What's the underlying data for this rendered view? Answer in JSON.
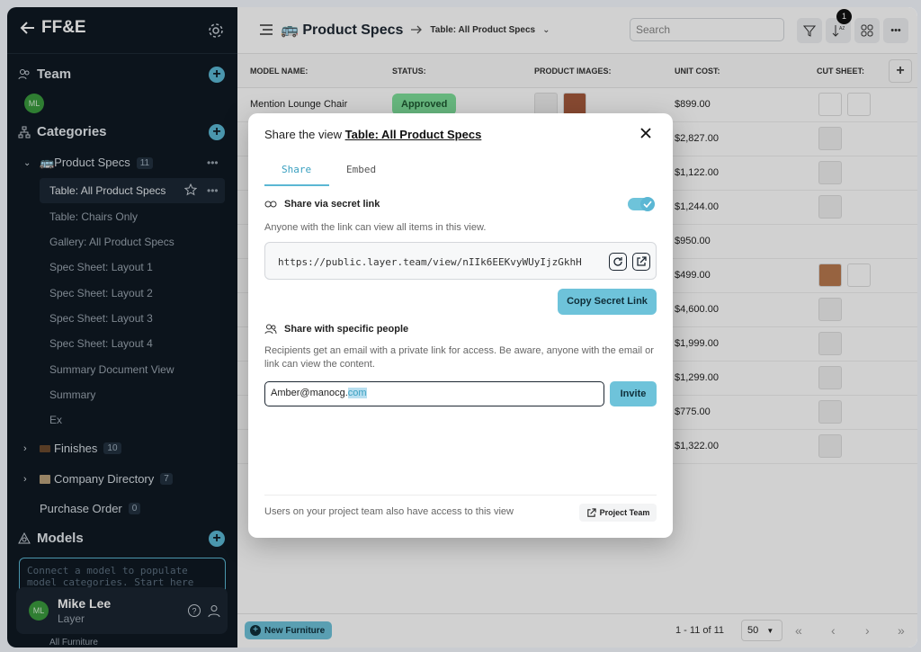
{
  "sidebar": {
    "brand": "FF&E",
    "team_label": "Team",
    "team_avatar": "ML",
    "categories_label": "Categories",
    "product_specs": {
      "label": "🚌Product Specs",
      "count": "11"
    },
    "views": [
      "Table: All Product Specs",
      "Table: Chairs Only",
      "Gallery: All Product Specs",
      "Spec Sheet: Layout 1",
      "Spec Sheet: Layout 2",
      "Spec Sheet: Layout 3",
      "Spec Sheet: Layout 4",
      "Summary Document View",
      "Summary",
      "Ex"
    ],
    "finishes": {
      "label": "Finishes",
      "count": "10"
    },
    "company_directory": {
      "label": "Company Directory",
      "count": "7"
    },
    "purchase_order": {
      "label": "Purchase Order",
      "count": "0"
    },
    "models_label": "Models",
    "model_placeholder": "Connect a model to populate model categories. Start here",
    "user": {
      "initials": "ML",
      "name": "Mike Lee",
      "org": "Layer"
    },
    "footer_peek": "All Furniture"
  },
  "topbar": {
    "title": "🚌 Product Specs",
    "view": "Table: All Product Specs",
    "search_placeholder": "Search",
    "notif_count": "1"
  },
  "table": {
    "headers": [
      "MODEL NAME:",
      "STATUS:",
      "PRODUCT IMAGES:",
      "UNIT COST:",
      "CUT SHEET:"
    ],
    "first_row": {
      "name": "Mention Lounge Chair",
      "status": "Approved",
      "cost": "$899.00"
    },
    "costs": [
      "$2,827.00",
      "$1,122.00",
      "$1,244.00",
      "$950.00",
      "$499.00",
      "$4,600.00",
      "$1,999.00",
      "$1,299.00",
      "$775.00",
      "$1,322.00"
    ]
  },
  "footer": {
    "new_label": "New Furniture",
    "range": "1 - 11 of 11",
    "page_size": "50"
  },
  "modal": {
    "title_prefix": "Share the view ",
    "title_view": "Table: All Product Specs",
    "tab_share": "Share",
    "tab_embed": "Embed",
    "secret_heading": "Share via secret link",
    "secret_desc": "Anyone with the link can view all items in this view.",
    "secret_link": "https://public.layer.team/view/nIIk6EEKvyWUyIjzGkhH",
    "copy_label": "Copy Secret Link",
    "people_heading": "Share with specific people",
    "people_desc": "Recipients get an email with a private link for access. Be aware, anyone with the email or link can view the content.",
    "email_value": "Amber@manocg.",
    "email_selected": "com",
    "invite_label": "Invite",
    "footer_text": "Users on your project team also have access to this view",
    "project_team_label": "Project Team"
  },
  "colors": {
    "accent": "#6ec3da",
    "sidebar_bg": "#0f1923",
    "approved": "#7ee09a"
  }
}
